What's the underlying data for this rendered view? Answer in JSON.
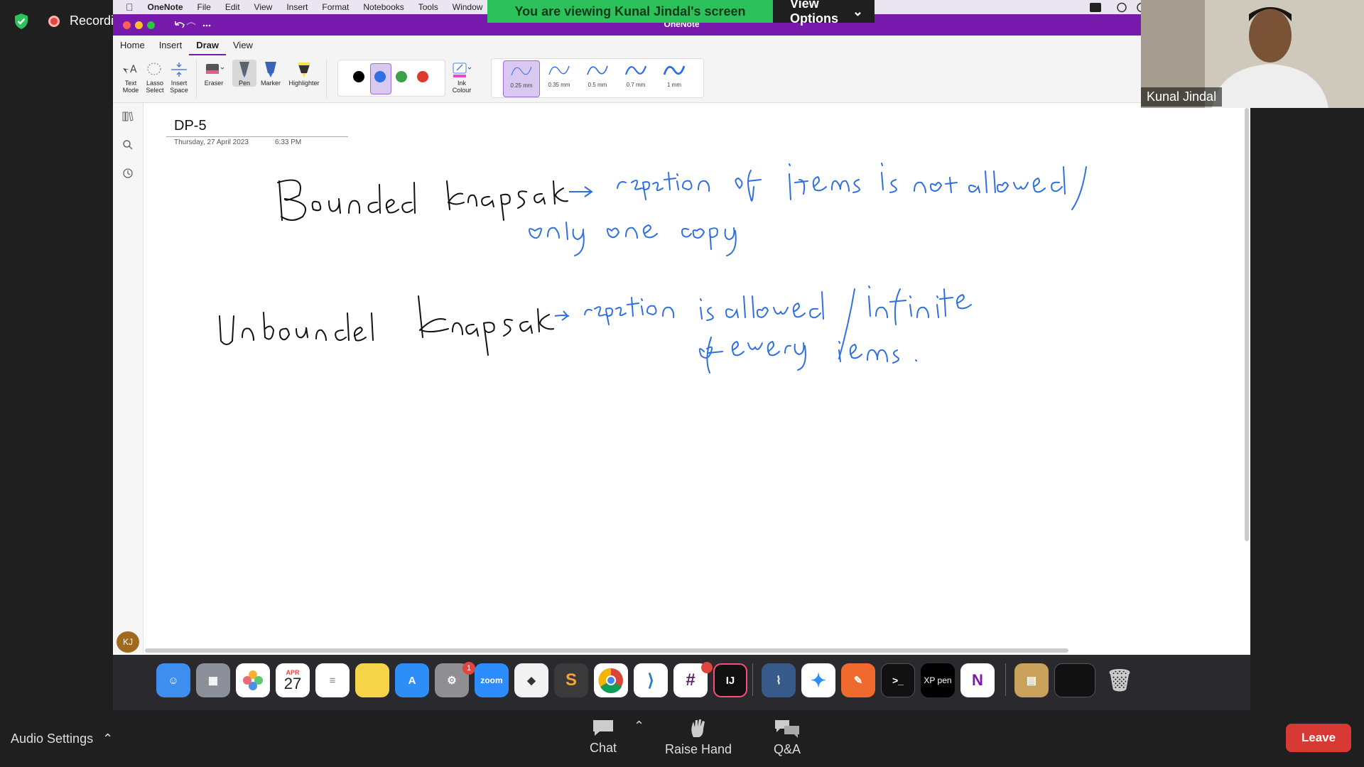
{
  "zoom": {
    "recording_label": "Recording",
    "share_banner": "You are viewing Kunal Jindal's screen",
    "view_options_label": "View Options",
    "participant_name": "Kunal Jindal",
    "audio_settings_label": "Audio Settings",
    "chat_label": "Chat",
    "raise_hand_label": "Raise Hand",
    "qa_label": "Q&A",
    "leave_label": "Leave"
  },
  "mac_menubar": {
    "app": "OneNote",
    "items": [
      "File",
      "Edit",
      "View",
      "Insert",
      "Format",
      "Notebooks",
      "Tools",
      "Window"
    ]
  },
  "onenote": {
    "window_title": "OneNote",
    "ribbon_tabs": [
      "Home",
      "Insert",
      "Draw",
      "View"
    ],
    "active_tab": "Draw",
    "tools": {
      "text_mode": "Text Mode",
      "lasso_select": "Lasso Select",
      "insert_space": "Insert Space",
      "eraser": "Eraser",
      "pen": "Pen",
      "marker": "Marker",
      "highlighter": "Highlighter",
      "ink_colour": "Ink Colour"
    },
    "ink_colors": [
      "#000000",
      "#2f6fe4",
      "#3aa04a",
      "#e03a2f"
    ],
    "selected_color": "#2f6fe4",
    "pen_widths": [
      "0.25 mm",
      "0.35 mm",
      "0.5 mm",
      "0.7 mm",
      "1 mm"
    ],
    "page": {
      "title": "DP-5",
      "date": "Thursday, 27 April 2023",
      "time": "6:33 PM"
    },
    "user_initials": "KJ",
    "ink_notes": [
      "Bounded knapsack -> repetition of items is not allowed / only one copy",
      "Unbounded knapsack -> repetition is allowed / infinite of every items."
    ]
  },
  "dock": {
    "calendar_month": "APR",
    "calendar_day": "27",
    "zoom_app_label": "zoom",
    "settings_badge": "1",
    "xppen_label": "XP pen"
  }
}
